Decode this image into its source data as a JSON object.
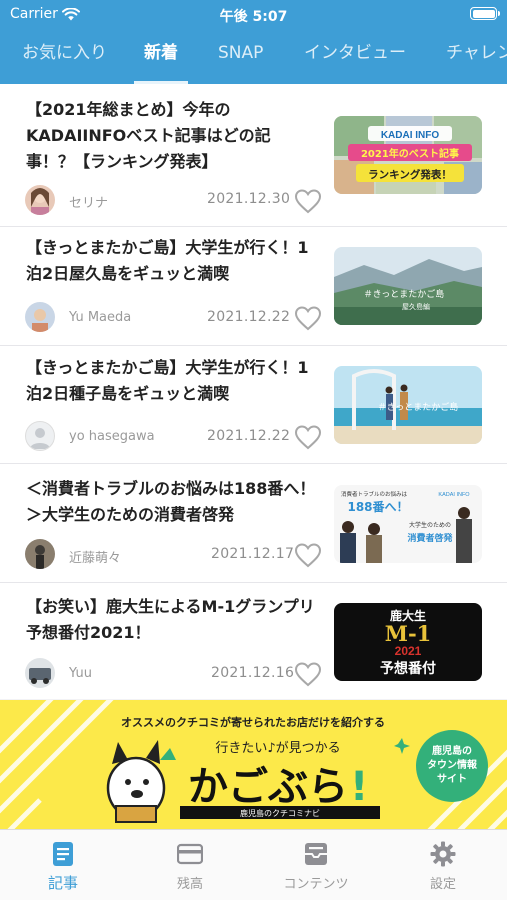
{
  "status_bar": {
    "carrier": "Carrier",
    "time": "午後 5:07",
    "battery_icon": "battery-full-icon"
  },
  "category_tabs": [
    {
      "label": "お気に入り",
      "active": false
    },
    {
      "label": "新着",
      "active": true
    },
    {
      "label": "SNAP",
      "active": false
    },
    {
      "label": "インタビュー",
      "active": false
    },
    {
      "label": "チャレン",
      "active": false
    }
  ],
  "articles": [
    {
      "title": "【2021年総まとめ】今年のKADAIINFOベスト記事はどの記事！？【ランキング発表】",
      "author": "セリナ",
      "date": "2021.12.30",
      "thumb_lines": [
        "KADAI INFO",
        "2021年のベスト記事",
        "ランキング発表！"
      ]
    },
    {
      "title": "【きっとまたかご島】大学生が行く！1泊2日屋久島をギュッと満喫",
      "author": "Yu Maeda",
      "date": "2021.12.22",
      "thumb_lines": [
        "＃きっとまたかご島",
        "屋久島編"
      ]
    },
    {
      "title": "【きっとまたかご島】大学生が行く！1泊2日種子島をギュッと満喫",
      "author": "yo hasegawa",
      "date": "2021.12.22",
      "thumb_lines": [
        "＃きっとまたかご島"
      ]
    },
    {
      "title": "＜消費者トラブルのお悩みは188番へ！＞大学生のための消費者啓発",
      "author": "近藤萌々",
      "date": "2021.12.17",
      "thumb_lines": [
        "消費者トラブルのお悩みは",
        "188番へ！",
        "KADAI INFO",
        "大学生のための",
        "消費者啓発"
      ]
    },
    {
      "title": "【お笑い】鹿大生によるM-1グランプリ予想番付2021！",
      "author": "Yuu",
      "date": "2021.12.16",
      "thumb_lines": [
        "鹿大生",
        "M-1",
        "2021",
        "予想番付"
      ]
    }
  ],
  "banner": {
    "top_text": "オススメのクチコミが寄せられたお店だけを紹介する",
    "tagline": "行きたい♪が見つかる",
    "logo": "かごぶら",
    "logo_mark": "!",
    "sub": "鹿児島のクチコミナビ",
    "badge": [
      "鹿児島の",
      "タウン情報",
      "サイト"
    ]
  },
  "tab_bar": [
    {
      "label": "記事",
      "icon": "article-icon",
      "active": true
    },
    {
      "label": "残高",
      "icon": "card-icon",
      "active": false
    },
    {
      "label": "コンテンツ",
      "icon": "inbox-icon",
      "active": false
    },
    {
      "label": "設定",
      "icon": "gear-icon",
      "active": false
    }
  ],
  "colors": {
    "accent": "#3e9ed6",
    "banner_yellow": "#fce94a",
    "banner_green": "#33b07a",
    "heart_outline": "#a8a8a8"
  }
}
